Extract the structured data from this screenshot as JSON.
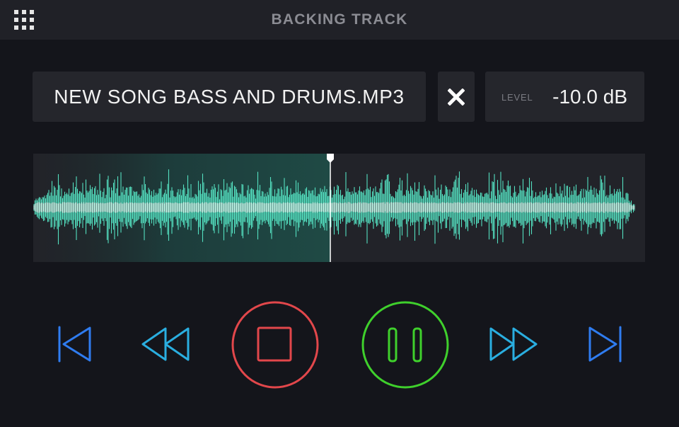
{
  "header": {
    "title": "BACKING TRACK",
    "menu_icon": "grid-menu-icon"
  },
  "track": {
    "filename": "NEW SONG BASS AND DRUMS.MP3",
    "close_icon": "close-icon"
  },
  "level": {
    "label": "LEVEL",
    "value": "-10.0 dB"
  },
  "playback": {
    "position_fraction": 0.485,
    "state": "playing"
  },
  "transport": {
    "buttons": [
      {
        "name": "skip-to-start",
        "icon": "skip-back-icon",
        "color": "#2f7cf0"
      },
      {
        "name": "rewind",
        "icon": "rewind-icon",
        "color": "#2aaee0"
      },
      {
        "name": "stop",
        "icon": "stop-icon",
        "color": "#e2474b"
      },
      {
        "name": "pause",
        "icon": "pause-icon",
        "color": "#3fd02c"
      },
      {
        "name": "fast-forward",
        "icon": "fast-forward-icon",
        "color": "#2aaee0"
      },
      {
        "name": "skip-to-end",
        "icon": "skip-forward-icon",
        "color": "#2f7cf0"
      }
    ]
  },
  "colors": {
    "waveform": "#54e0c0",
    "waveform_core": "#d8fbf1",
    "played_region": "#1f4a45"
  }
}
